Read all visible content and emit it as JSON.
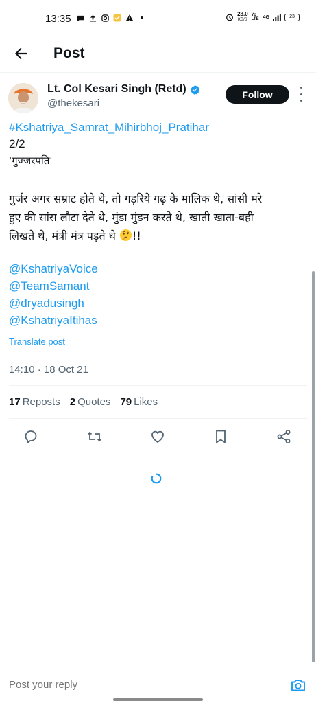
{
  "status_bar": {
    "time": "13:35",
    "net_speed": "28.0",
    "net_unit": "KB/S",
    "volte": "Yo LTE",
    "network": "4G",
    "battery": "23"
  },
  "header": {
    "title": "Post"
  },
  "author": {
    "name": "Lt. Col Kesari Singh (Retd)",
    "handle": "@thekesari",
    "follow_label": "Follow"
  },
  "tweet": {
    "hashtag": "#Kshatriya_Samrat_Mihirbhoj_Pratihar",
    "line2": "2/2",
    "line3": "'गुज्जरपति'",
    "para_line1": "गुर्जर अगर सम्राट होते थे, तो गड़रिये गढ़ के मालिक थे, सांसी मरे",
    "para_line2": "हुए की सांस लौटा देते थे, मुंडा मुंडन करते थे, खाती खाता-बही",
    "para_line3": "लिखते थे, मंत्री मंत्र पड़ते थे",
    "para_end": "!!",
    "emoji": "thinking-face",
    "mentions": [
      "@KshatriyaVoice",
      "@TeamSamant",
      "@dryadusingh",
      "@KshatriyaItihas"
    ],
    "translate_label": "Translate post",
    "timestamp": "14:10 · 18 Oct 21"
  },
  "stats": {
    "reposts_count": "17",
    "reposts_label": "Reposts",
    "quotes_count": "2",
    "quotes_label": "Quotes",
    "likes_count": "79",
    "likes_label": "Likes"
  },
  "reply": {
    "placeholder": "Post your reply"
  },
  "colors": {
    "accent": "#1d9bf0",
    "text": "#0f1419",
    "muted": "#536471",
    "divider": "#eff3f4"
  }
}
